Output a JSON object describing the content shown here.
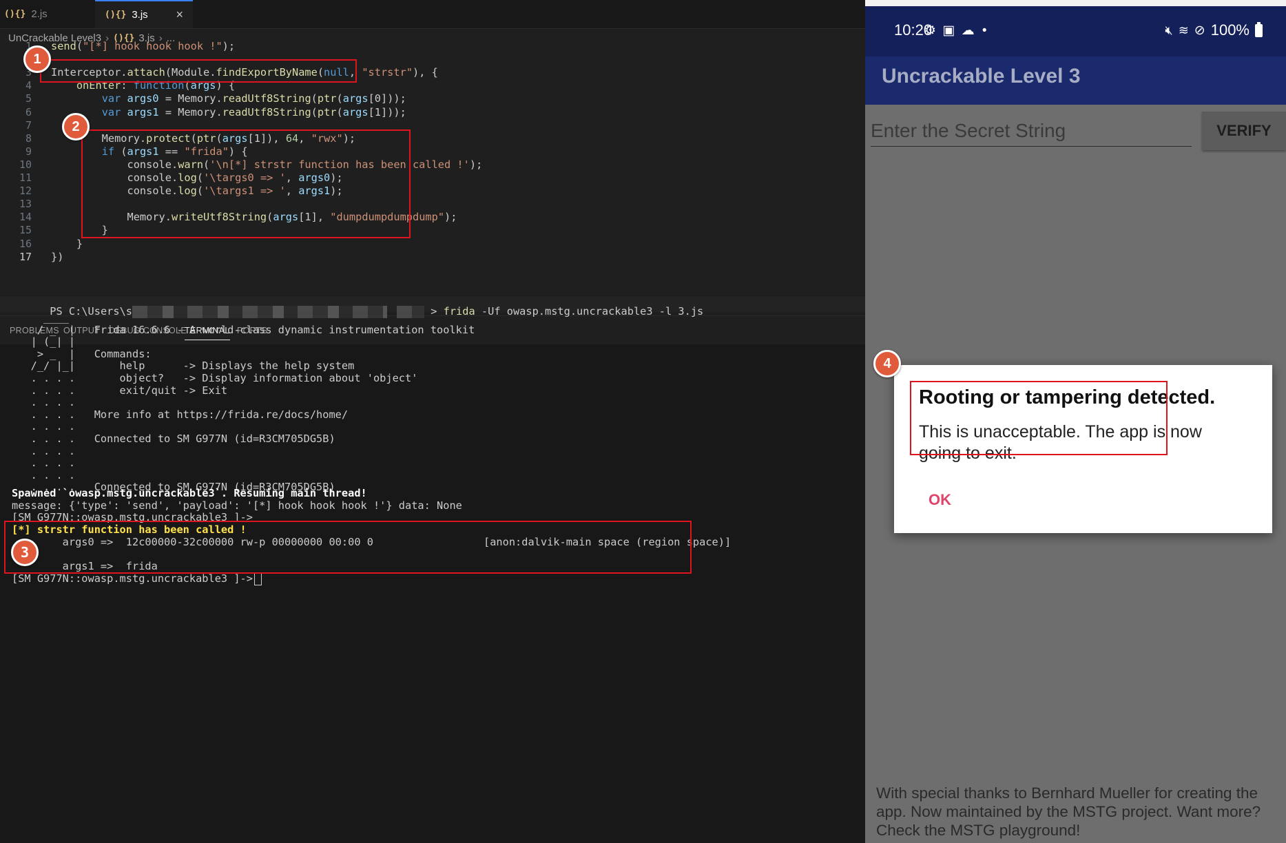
{
  "editor": {
    "tabs": [
      {
        "icon": "(){}",
        "icon_text": "{}",
        "label": "2.js"
      },
      {
        "icon": "(){}",
        "icon_text": "{}",
        "label": "3.js",
        "close": "×"
      }
    ],
    "breadcrumb": {
      "folder": "UnCrackable Level3",
      "file": "3.js",
      "more": "..."
    },
    "code_lines": [
      "send(\"[*] hook hook hook !\");",
      "",
      "Interceptor.attach(Module.findExportByName(null, \"strstr\"), {",
      "    onEnter: function(args) {",
      "        var args0 = Memory.readUtf8String(ptr(args[0]));",
      "        var args1 = Memory.readUtf8String(ptr(args[1]));",
      "",
      "        Memory.protect(ptr(args[1]), 64, \"rwx\");",
      "        if (args1 == \"frida\") {",
      "            console.warn('\\n[*] strstr function has been called !');",
      "            console.log('\\targs0 => ', args0);",
      "            console.log('\\targs1 => ', args1);",
      "",
      "            Memory.writeUtf8String(args[1], \"dumpdumpdumpdump\");",
      "        }",
      "    }",
      "})"
    ],
    "line_numbers": [
      "1",
      "2",
      "3",
      "4",
      "5",
      "6",
      "7",
      "8",
      "9",
      "10",
      "11",
      "12",
      "13",
      "14",
      "15",
      "16",
      "17"
    ]
  },
  "panel": {
    "tabs": [
      "PROBLEMS",
      "OUTPUT",
      "DEBUG CONSOLE",
      "TERMINAL",
      "PORTS"
    ],
    "active_tab": "TERMINAL"
  },
  "terminal": {
    "prompt_prefix": "PS C:\\Users\\s",
    "command": "frida",
    "command_args": " -Uf owasp.mstg.uncrackable3 -l 3.js",
    "banner": [
      "     ____",
      "    / _  |   Frida 16.6.6 - A world-class dynamic instrumentation toolkit",
      "   | (_| |",
      "    > _  |   Commands:",
      "   /_/ |_|       help      -> Displays the help system",
      "   . . . .       object?   -> Display information about 'object'",
      "   . . . .       exit/quit -> Exit",
      "   . . . .",
      "   . . . .   More info at https://frida.re/docs/home/",
      "   . . . .",
      "   . . . .   Connected to SM G977N (id=R3CM705DG5B)",
      "   . . . .",
      "   . . . .",
      "   . . . .",
      "   . . . .   Connected to SM G977N (id=R3CM705DG5B)"
    ],
    "spawned": "Spawned `owasp.mstg.uncrackable3`. Resuming main thread!",
    "message": "message: {'type': 'send', 'payload': '[*] hook hook hook !'} data: None",
    "prompt1": "[SM G977N::owasp.mstg.uncrackable3 ]->",
    "warn": "[*] strstr function has been called !",
    "args0": "        args0 =>  12c00000-32c00000 rw-p 00000000 00:00 0",
    "args0_region": "[anon:dalvik-main space (region space)]",
    "args1": "        args1 =>  frida",
    "prompt2": "[SM G977N::owasp.mstg.uncrackable3 ]->"
  },
  "annotations": {
    "b1": "1",
    "b2": "2",
    "b3": "3",
    "b4": "4"
  },
  "phone": {
    "status": {
      "time": "10:20",
      "battery": "100%"
    },
    "app_title": "Uncrackable Level 3",
    "input_placeholder": "Enter the Secret String",
    "verify_label": "VERIFY",
    "dialog": {
      "title": "Rooting or tampering detected.",
      "message": "This is unacceptable. The app is now going to exit.",
      "ok": "OK"
    },
    "footer": "With special thanks to Bernhard Mueller for creating the app. Now maintained by the MSTG project. Want more? Check the MSTG playground!"
  }
}
